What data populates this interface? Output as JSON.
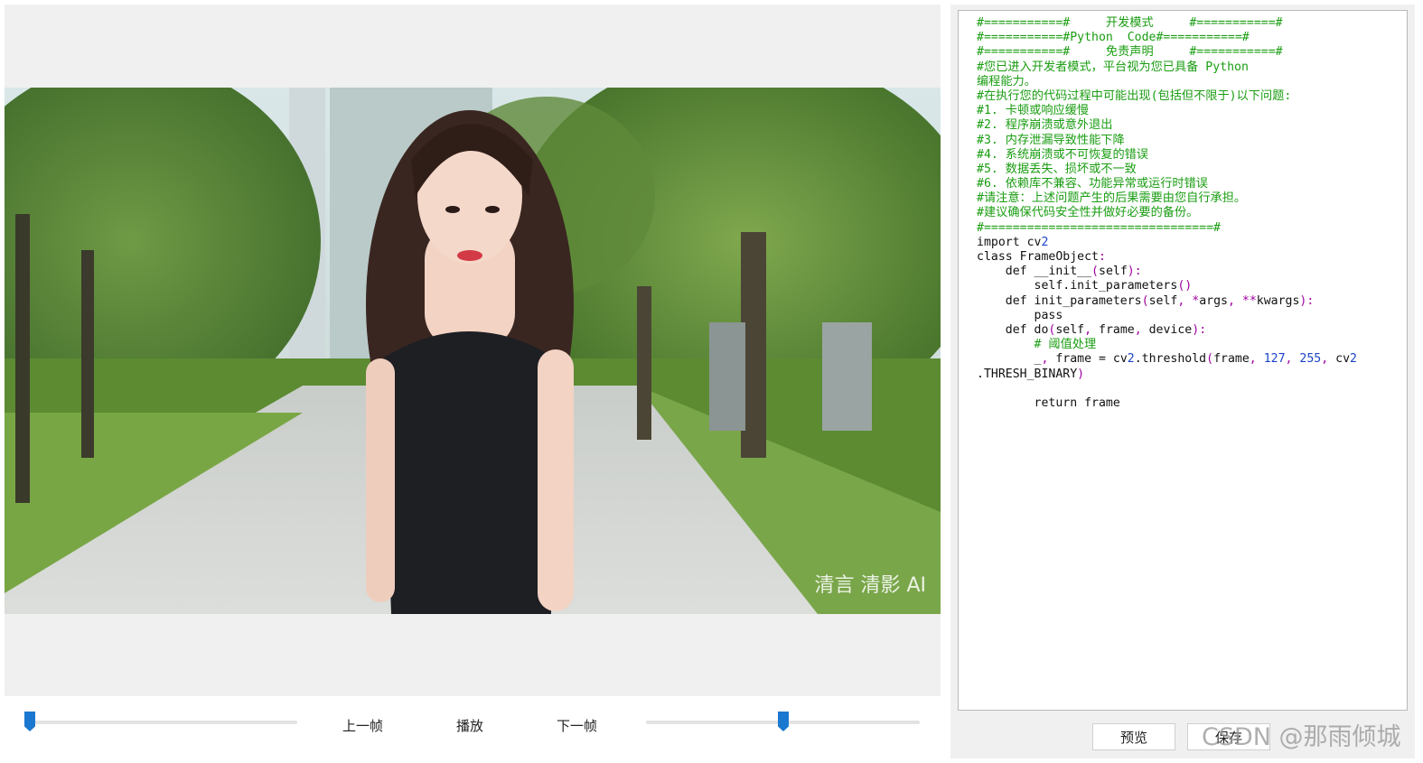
{
  "viewer": {
    "watermark": "清言 清影 AI",
    "controls": {
      "prev_frame_label": "上一帧",
      "play_label": "播放",
      "next_frame_label": "下一帧",
      "frame_slider_value": 0.0,
      "speed_slider_value": 0.5
    }
  },
  "editor": {
    "code_lines": [
      "#===========#     开发模式     #===========#",
      "#===========#Python  Code#===========#",
      "#===========#     免责声明     #===========#",
      "#您已进入开发者模式，平台视为您已具备 Python",
      "编程能力。",
      "#在执行您的代码过程中可能出现(包括但不限于)以下问题:",
      "#1. 卡顿或响应缓慢",
      "#2. 程序崩溃或意外退出",
      "#3. 内存泄漏导致性能下降",
      "#4. 系统崩溃或不可恢复的错误",
      "#5. 数据丢失、损坏或不一致",
      "#6. 依赖库不兼容、功能异常或运行时错误",
      "#请注意：上述问题产生的后果需要由您自行承担。",
      "#建议确保代码安全性并做好必要的备份。",
      "#================================#",
      "import cv2",
      "class FrameObject:",
      "    def __init__(self):",
      "        self.init_parameters()",
      "    def init_parameters(self, *args, **kwargs):",
      "        pass",
      "    def do(self, frame, device):",
      "        # 阈值处理",
      "        _, frame = cv2.threshold(frame, 127, 255, cv2",
      ".THRESH_BINARY)",
      "",
      "        return frame"
    ],
    "preview_label": "预览",
    "save_label": "保存"
  },
  "site_watermark": "CSDN @那雨倾城",
  "colors": {
    "comment": "#1a9d12",
    "keyword_punct": "#a000a0",
    "number": "#1a44c8",
    "slider_thumb": "#1b78d0",
    "panel_bg": "#f0f0f0"
  }
}
